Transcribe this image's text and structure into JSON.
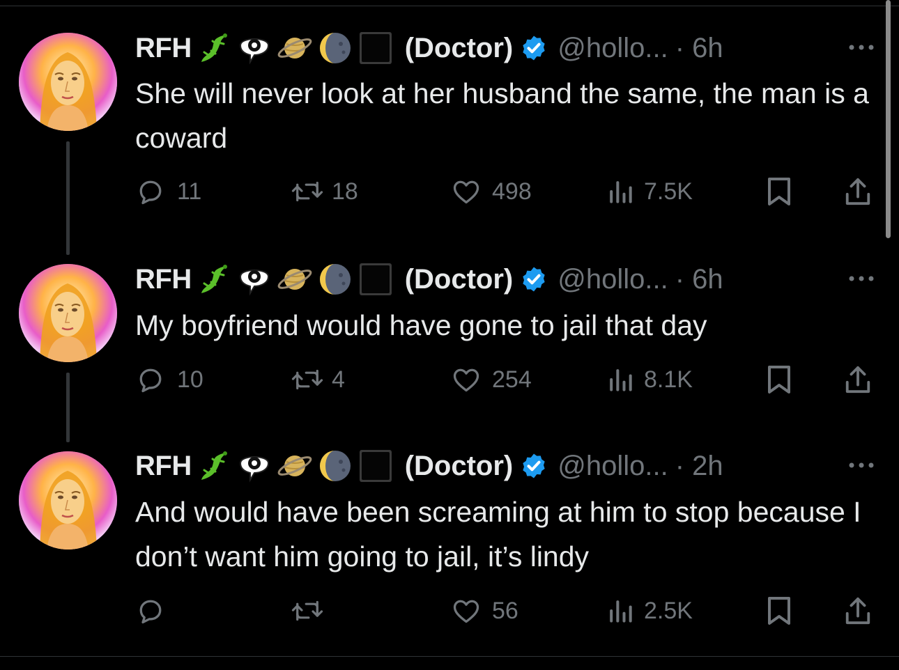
{
  "tweets": [
    {
      "name": "RFH",
      "label": "(Doctor)",
      "handle": "@hollo...",
      "time": "· 6h",
      "text": "She will never look at her husband the same, the man is a coward",
      "replies": "11",
      "reposts": "18",
      "likes": "498",
      "views": "7.5K"
    },
    {
      "name": "RFH",
      "label": "(Doctor)",
      "handle": "@hollo...",
      "time": "· 6h",
      "text": "My boyfriend would have gone to jail that day",
      "replies": "10",
      "reposts": "4",
      "likes": "254",
      "views": "8.1K"
    },
    {
      "name": "RFH",
      "label": "(Doctor)",
      "handle": "@hollo...",
      "time": "· 2h",
      "text": "And would have been screaming at him to stop because I don’t want him going to jail, it’s lindy",
      "replies": "",
      "reposts": "",
      "likes": "56",
      "views": "2.5K"
    }
  ],
  "icons": {
    "name_emojis": [
      "lizard-icon",
      "eye-in-speech-bubble-icon",
      "ringed-planet-icon",
      "last-quarter-moon-face-icon",
      "black-large-square-icon"
    ],
    "verified": "verified-badge-icon",
    "more": "more-options-icon",
    "reply": "reply-icon",
    "repost": "repost-icon",
    "like": "like-icon",
    "views": "views-icon",
    "bookmark": "bookmark-icon",
    "share": "share-icon"
  },
  "colors": {
    "background": "#000000",
    "text": "#e7e9ea",
    "secondary": "#71767b",
    "verified": "#1d9bf0",
    "divider": "#2f3336"
  }
}
